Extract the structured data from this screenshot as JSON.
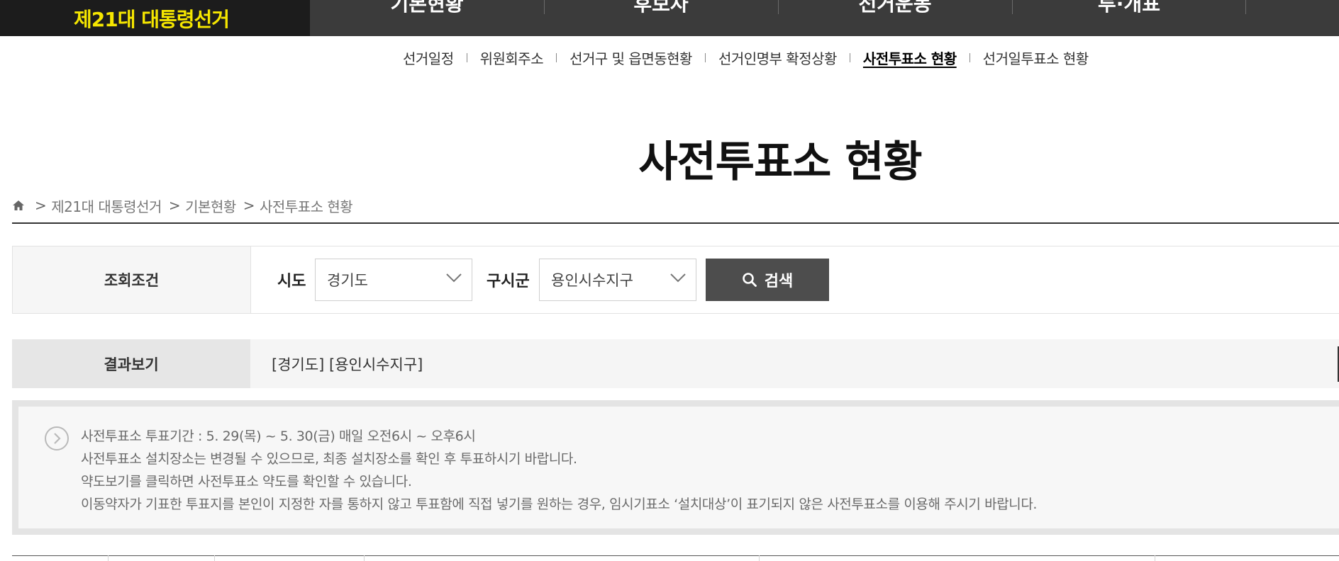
{
  "brand": {
    "title": "제21대 대통령선거",
    "color": "#f5e600"
  },
  "gnb": [
    "기본현황",
    "후보자",
    "선거운동",
    "투·개표"
  ],
  "subnav": [
    {
      "label": "선거일정",
      "active": false
    },
    {
      "label": "위원회주소",
      "active": false
    },
    {
      "label": "선거구 및 읍면동현황",
      "active": false
    },
    {
      "label": "선거인명부 확정상황",
      "active": false
    },
    {
      "label": "사전투표소 현황",
      "active": true
    },
    {
      "label": "선거일투표소 현황",
      "active": false
    }
  ],
  "page_title": "사전투표소 현황",
  "breadcrumb": {
    "home_icon": "home-icon",
    "separator": ">",
    "items": [
      "제21대 대통령선거",
      "기본현황",
      "사전투표소 현황"
    ]
  },
  "search": {
    "condition_label": "조회조건",
    "sido_label": "시도",
    "sido_value": "경기도",
    "gusigun_label": "구시군",
    "gusigun_value": "용인시수지구",
    "button_label": "검색",
    "button_icon": "search-icon"
  },
  "result": {
    "label": "결과보기",
    "text": "[경기도] [용인시수지구]"
  },
  "notice": {
    "icon": "chevron-right-circle-icon",
    "lines": [
      "사전투표소 투표기간 : 5. 29(목) ~ 5. 30(금) 매일 오전6시 ~ 오후6시",
      "사전투표소 설치장소는 변경될 수 있으므로, 최종 설치장소를 확인 후 투표하시기 바랍니다.",
      "약도보기를 클릭하면 사전투표소 약도를 확인할 수 있습니다.",
      "이동약자가 기표한 투표지를 본인이 지정한 자를 통하지 않고 투표함에 직접 넣기를 원하는 경우, 임시기표소 ‘설치대상’이 표기되지 않은 사전투표소를 이용해 주시기 바랍니다."
    ]
  }
}
